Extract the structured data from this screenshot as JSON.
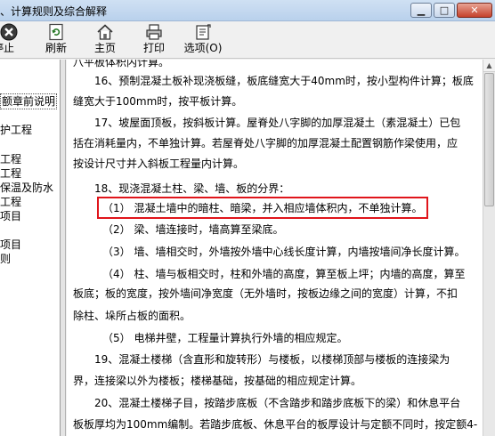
{
  "window": {
    "title": "、计算规则及综合解释",
    "min_label": "▁",
    "max_label": "□",
    "close_label": "✕"
  },
  "toolbar": {
    "stop_label": "停止",
    "refresh_label": "刷新",
    "home_label": "主页",
    "print_label": "打印",
    "options_label": "选项(O)"
  },
  "sidebar": {
    "items": [
      {
        "label": "额章前说明",
        "selected": true
      },
      {
        "label": "护工程"
      },
      {
        "label": "工程"
      },
      {
        "label": "工程"
      },
      {
        "label": "保温及防水"
      },
      {
        "label": "工程"
      },
      {
        "label": "项目"
      },
      {
        "label": "项目"
      },
      {
        "label": "则"
      }
    ]
  },
  "content": {
    "lines": [
      "八平板体积内计算。",
      "16、预制混凝土板补现浇板缝，板底缝宽大于40mm时，按小型构件计算；板底",
      "缝宽大于100mm时，按平板计算。",
      "17、坡屋面顶板，按斜板计算。屋脊处八字脚的加厚混凝土（素混凝土）已包",
      "括在消耗量内，不单独计算。若屋脊处八字脚的加厚混凝土配置钢筋作梁使用，应",
      "按设计尺寸并入斜板工程量内计算。",
      "18、现浇混凝土柱、梁、墙、板的分界：",
      "（1） 混凝土墙中的暗柱、暗梁，并入相应墙体积内，不单独计算。",
      "（2） 梁、墙连接时，墙高算至梁底。",
      "（3） 墙、墙相交时，外墙按外墙中心线长度计算，内墙按墙间净长度计算。",
      "（4） 柱、墙与板相交时，柱和外墙的高度，算至板上坪；内墙的高度，算至",
      "板底；板的宽度，按外墙间净宽度（无外墙时，按板边缘之间的宽度）计算，不扣",
      "除柱、垛所占板的面积。",
      "（5） 电梯井壁，工程量计算执行外墙的相应规定。",
      "19、混凝土楼梯（含直形和旋转形）与楼板，以楼梯顶部与楼板的连接梁为",
      "界，连接梁以外为楼板；楼梯基础，按基础的相应规定计算。",
      "20、混凝土楼梯子目，按踏步底板（不含踏步和踏步底板下的梁）和休息平台",
      "板板厚均为100mm编制。若踏步底板、休息平台的板厚设计与定额不同时，按定额4-"
    ]
  },
  "colors": {
    "highlight_border": "#e0151b",
    "titlebar": "#b9d1ec"
  },
  "icons": {
    "stop": "stop-icon",
    "refresh": "refresh-icon",
    "home": "home-icon",
    "print": "printer-icon",
    "options": "options-icon"
  }
}
